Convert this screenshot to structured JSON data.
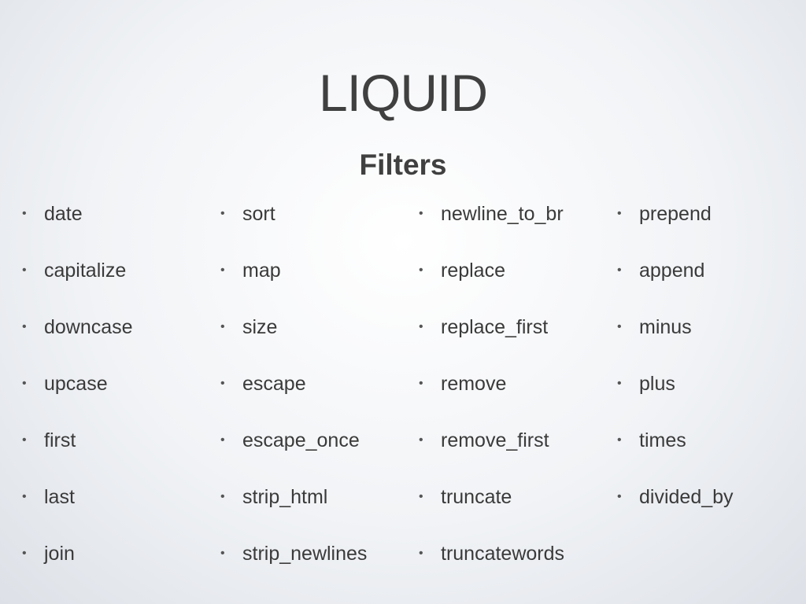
{
  "slide": {
    "title": "LIQUID",
    "subtitle": "Filters",
    "bullet": "•",
    "columns": [
      [
        "date",
        "capitalize",
        "downcase",
        "upcase",
        "first",
        "last",
        "join"
      ],
      [
        "sort",
        "map",
        "size",
        "escape",
        "escape_once",
        "strip_html",
        "strip_newlines"
      ],
      [
        "newline_to_br",
        "replace",
        "replace_first",
        "remove",
        "remove_first",
        "truncate",
        "truncatewords"
      ],
      [
        "prepend",
        "append",
        "minus",
        "plus",
        "times",
        "divided_by"
      ]
    ]
  }
}
